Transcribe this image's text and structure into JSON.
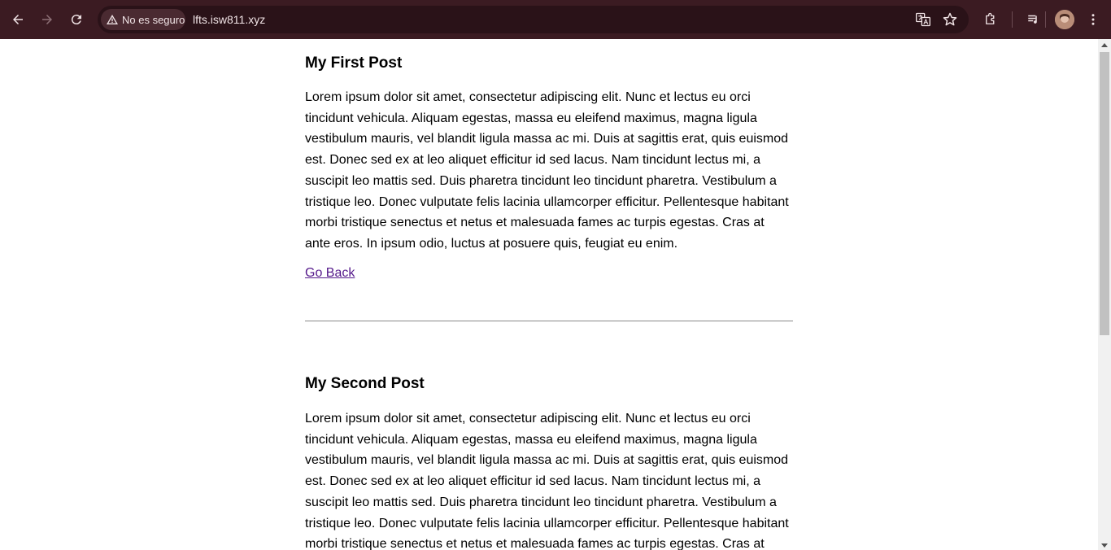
{
  "browser": {
    "security_label": "No es seguro",
    "url": "lfts.isw811.xyz",
    "icons": [
      "back-icon",
      "forward-icon",
      "reload-icon",
      "warning-icon",
      "translate-icon",
      "bookmark-star-icon",
      "extensions-icon",
      "media-control-icon",
      "profile-avatar",
      "menu-icon"
    ],
    "colors": {
      "toolbar": "#3b1b22",
      "omnibox": "#2a1218",
      "icon": "#f1e4e6",
      "icon_disabled": "#8c6f75"
    }
  },
  "posts": [
    {
      "title": "My First Post",
      "body": "Lorem ipsum dolor sit amet, consectetur adipiscing elit. Nunc et lectus eu orci tincidunt vehicula. Aliquam egestas, massa eu eleifend maximus, magna ligula vestibulum mauris, vel blandit ligula massa ac mi. Duis at sagittis erat, quis euismod est. Donec sed ex at leo aliquet efficitur id sed lacus. Nam tincidunt lectus mi, a suscipit leo mattis sed. Duis pharetra tincidunt leo tincidunt pharetra. Vestibulum a tristique leo. Donec vulputate felis lacinia ullamcorper efficitur. Pellentesque habitant morbi tristique senectus et netus et malesuada fames ac turpis egestas. Cras at ante eros. In ipsum odio, luctus at posuere quis, feugiat eu enim.",
      "link": "Go Back"
    },
    {
      "title": "My Second Post",
      "body": "Lorem ipsum dolor sit amet, consectetur adipiscing elit. Nunc et lectus eu orci tincidunt vehicula. Aliquam egestas, massa eu eleifend maximus, magna ligula vestibulum mauris, vel blandit ligula massa ac mi. Duis at sagittis erat, quis euismod est. Donec sed ex at leo aliquet efficitur id sed lacus. Nam tincidunt lectus mi, a suscipit leo mattis sed. Duis pharetra tincidunt leo tincidunt pharetra. Vestibulum a tristique leo. Donec vulputate felis lacinia ullamcorper efficitur. Pellentesque habitant morbi tristique senectus et netus et malesuada fames ac turpis egestas. Cras at"
    }
  ]
}
